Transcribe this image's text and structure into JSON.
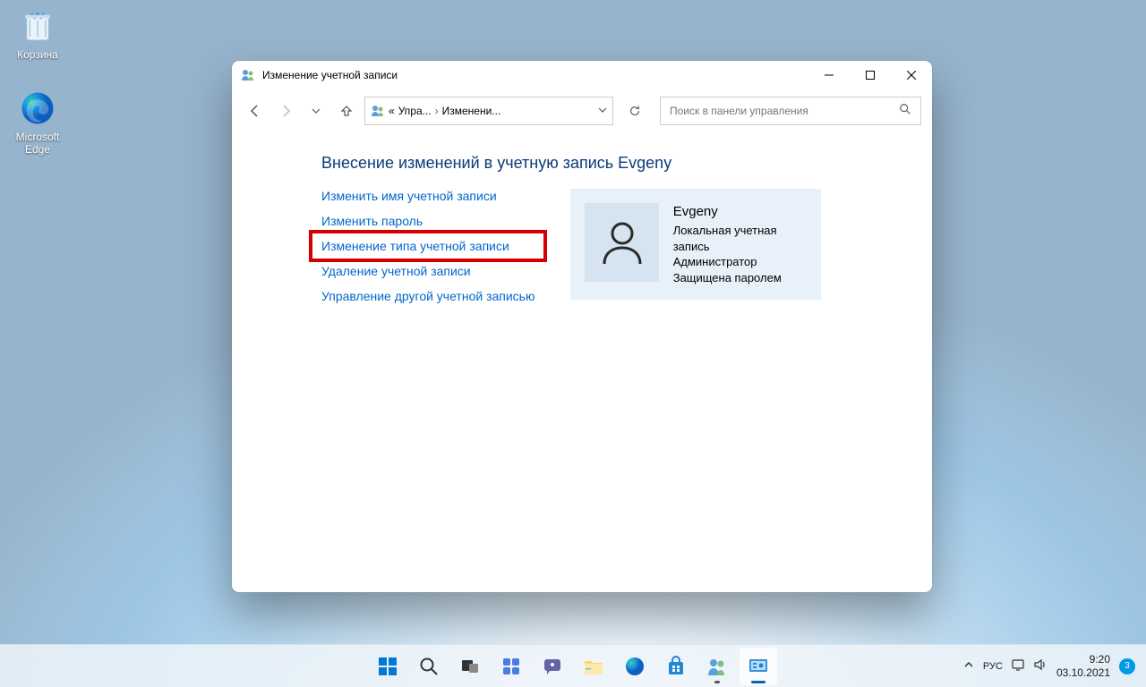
{
  "desktop_icons": {
    "recycle": "Корзина",
    "edge_l1": "Microsoft",
    "edge_l2": "Edge"
  },
  "window": {
    "title": "Изменение учетной записи",
    "breadcrumb": {
      "part1": "Упра...",
      "part2": "Изменени..."
    },
    "search_placeholder": "Поиск в панели управления",
    "heading": "Внесение изменений в учетную запись Evgeny",
    "links": {
      "rename": "Изменить имя учетной записи",
      "change_password": "Изменить пароль",
      "change_type": "Изменение типа учетной записи",
      "delete": "Удаление учетной записи",
      "manage_other": "Управление другой учетной записью"
    },
    "account": {
      "name": "Evgeny",
      "type": "Локальная учетная запись",
      "role": "Администратор",
      "protected": "Защищена паролем"
    }
  },
  "taskbar": {
    "lang": "РУС",
    "time": "9:20",
    "date": "03.10.2021",
    "notif": "3"
  }
}
